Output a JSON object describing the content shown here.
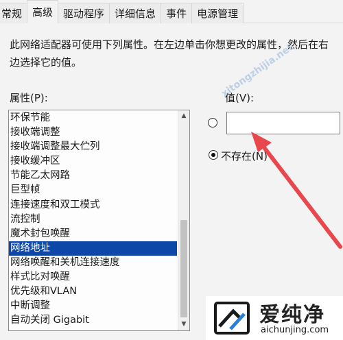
{
  "tabs": [
    {
      "label": "常规",
      "active": false
    },
    {
      "label": "高级",
      "active": true
    },
    {
      "label": "驱动程序",
      "active": false
    },
    {
      "label": "详细信息",
      "active": false
    },
    {
      "label": "事件",
      "active": false
    },
    {
      "label": "电源管理",
      "active": false
    }
  ],
  "description_line1": "此网络适配器可使用下列属性。在左边单击你想更改的属性，然后在右",
  "description_line2": "边选择它的值。",
  "properties_label": "属性(P):",
  "properties": [
    "环保节能",
    "接收端调整",
    "接收端调整最大伫列",
    "接收缓冲区",
    "节能乙太网路",
    "巨型帧",
    "连接速度和双工模式",
    "流控制",
    "魔术封包唤醒",
    "网络地址",
    "网络唤醒和关机连接速度",
    "样式比对唤醒",
    "优先级和VLAN",
    "中断调整",
    "自动关闭 Gigabit"
  ],
  "selected_index": 9,
  "value_label": "值(V):",
  "value_input": "",
  "not_present_label": "不存在(N)",
  "watermark_text": "xitongzhijia.net",
  "logo_text": "爱纯净",
  "logo_url": "aichunjing.com",
  "colors": {
    "selection": "#0d48a8",
    "arrow": "#e8474e"
  }
}
